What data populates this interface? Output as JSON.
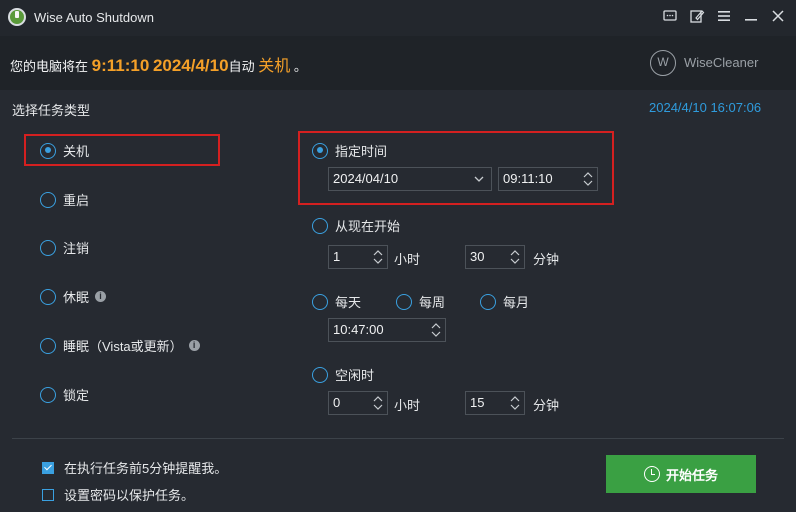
{
  "window": {
    "title": "Wise Auto Shutdown"
  },
  "titlebar_icons": [
    "feedback-icon",
    "edit-icon",
    "menu-icon",
    "minimize-icon",
    "close-icon"
  ],
  "banner": {
    "prefix": "您的电脑将在",
    "time": "9:11:10",
    "date": "2024/4/10",
    "middle": "自动",
    "action": "关机",
    "suffix": "。",
    "brand": "WiseCleaner"
  },
  "tasks": {
    "section_label": "选择任务类型",
    "current_datetime": "2024/4/10 16:07:06",
    "options": [
      {
        "label": "关机",
        "checked": true
      },
      {
        "label": "重启",
        "checked": false
      },
      {
        "label": "注销",
        "checked": false
      },
      {
        "label": "休眠",
        "checked": false,
        "info": true
      },
      {
        "label": "睡眠（Vista或更新）",
        "checked": false,
        "info": true
      },
      {
        "label": "锁定",
        "checked": false
      }
    ]
  },
  "schedule": {
    "specific": {
      "label": "指定时间",
      "checked": true,
      "date": "2024/04/10",
      "time": "09:11:10"
    },
    "from_now": {
      "label": "从现在开始",
      "checked": false,
      "hours": "1",
      "hours_unit": "小时",
      "minutes": "30",
      "minutes_unit": "分钟"
    },
    "daily": {
      "label": "每天",
      "checked": false
    },
    "weekly": {
      "label": "每周",
      "checked": false
    },
    "monthly": {
      "label": "每月",
      "checked": false
    },
    "periodic_time": "10:47:00",
    "idle": {
      "label": "空闲时",
      "checked": false,
      "hours": "0",
      "hours_unit": "小时",
      "minutes": "15",
      "minutes_unit": "分钟"
    }
  },
  "footer": {
    "remind": {
      "label": "在执行任务前5分钟提醒我。",
      "checked": true
    },
    "password": {
      "label": "设置密码以保护任务。",
      "checked": false
    },
    "start_button": "开始任务"
  },
  "colors": {
    "accent": "#3aa0e0",
    "highlight": "#f4a028",
    "start_button": "#3aa043",
    "annotation_box": "#d42020",
    "date_text": "#2f9bdc"
  }
}
